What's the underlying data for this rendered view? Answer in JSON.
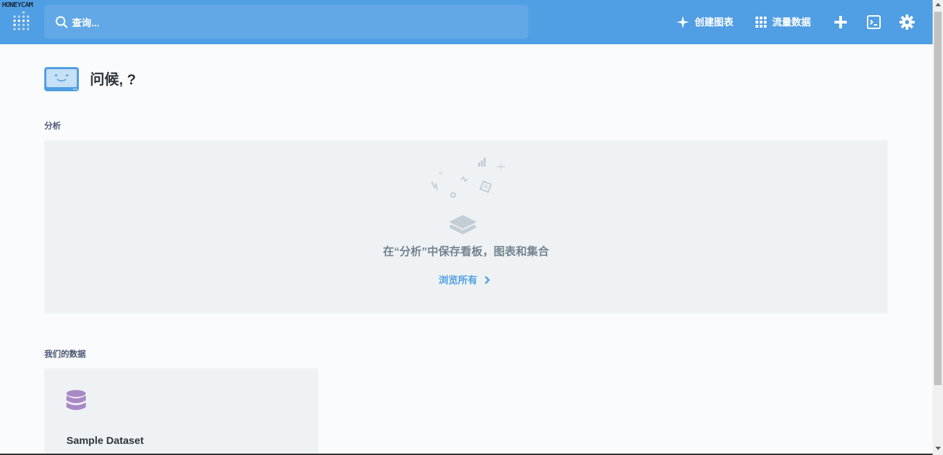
{
  "watermark": "HONEYCAM",
  "colors": {
    "brand": "#509ee3",
    "search_bg": "#62a8e6",
    "db_icon": "#a989c5"
  },
  "header": {
    "search_placeholder": "查询...",
    "create_label": "创建图表",
    "browse_label": "流量数据",
    "icons": [
      "metabase-logo-icon",
      "search-icon",
      "sparkle-icon",
      "grid-icon",
      "plus-icon",
      "sql-editor-icon",
      "gear-icon"
    ]
  },
  "greeting": {
    "title": "问候, ?"
  },
  "analytics": {
    "section_label": "分析",
    "empty_message": "在“分析”中保存看板，图表和集合",
    "browse_all": "浏览所有"
  },
  "our_data": {
    "section_label": "我们的数据",
    "databases": [
      {
        "name": "Sample Dataset",
        "icon": "database-icon"
      }
    ]
  }
}
